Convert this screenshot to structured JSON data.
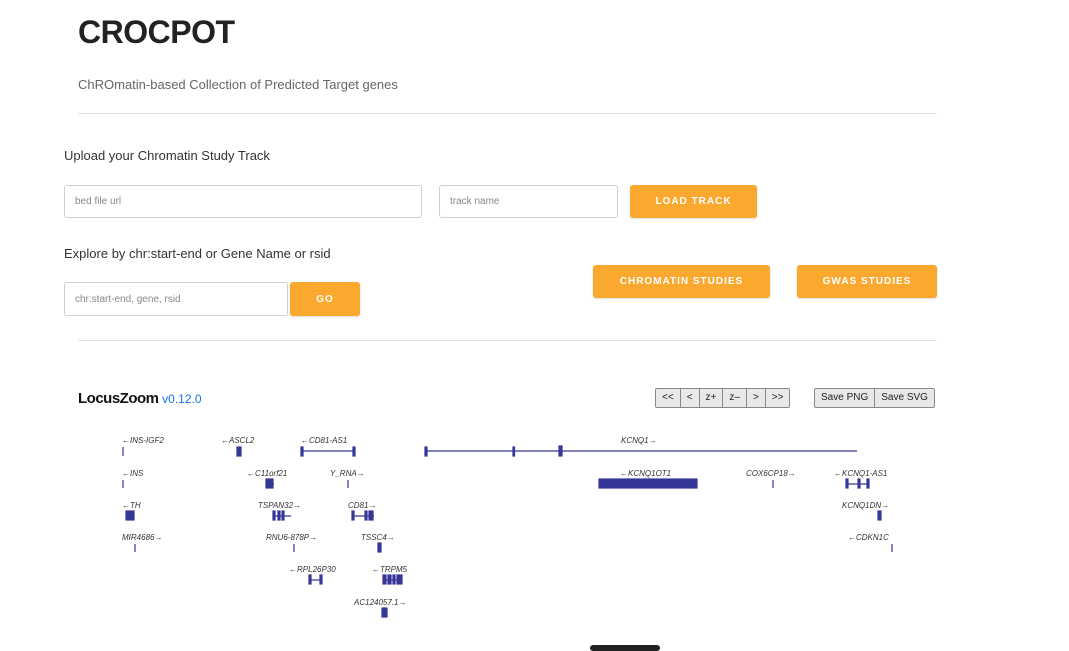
{
  "header": {
    "title": "CROCPOT",
    "subtitle": "ChROmatin-based Collection of Predicted Target genes"
  },
  "upload": {
    "label": "Upload your Chromatin Study Track",
    "bed_placeholder": "bed file url",
    "track_placeholder": "track name",
    "load_button": "LOAD TRACK"
  },
  "explore": {
    "label": "Explore by chr:start-end or Gene Name or rsid",
    "search_placeholder": "chr:start-end, gene, rsid",
    "go_button": "GO",
    "chromatin_button": "CHROMATIN STUDIES",
    "gwas_button": "GWAS STUDIES"
  },
  "locuszoom": {
    "name": "LocusZoom",
    "version": "v0.12.0",
    "nav_buttons": [
      "<<",
      "<",
      "z+",
      "z–",
      ">",
      ">>"
    ],
    "save_buttons": [
      "Save PNG",
      "Save SVG"
    ],
    "gene_color": "#363696",
    "genes": [
      {
        "label": "←INS-IGF2",
        "row": 0
      },
      {
        "label": "←ASCL2",
        "row": 0
      },
      {
        "label": "←CD81-AS1",
        "row": 0
      },
      {
        "label": "KCNQ1→",
        "row": 0
      },
      {
        "label": "←INS",
        "row": 1
      },
      {
        "label": "←C11orf21",
        "row": 1
      },
      {
        "label": "Y_RNA→",
        "row": 1
      },
      {
        "label": "←KCNQ1OT1",
        "row": 1
      },
      {
        "label": "COX6CP18→",
        "row": 1
      },
      {
        "label": "←KCNQ1-AS1",
        "row": 1
      },
      {
        "label": "←TH",
        "row": 2
      },
      {
        "label": "TSPAN32→",
        "row": 2
      },
      {
        "label": "CD81→",
        "row": 2
      },
      {
        "label": "KCNQ1DN→",
        "row": 2
      },
      {
        "label": "MIR4686→",
        "row": 3
      },
      {
        "label": "RNU6-878P→",
        "row": 3
      },
      {
        "label": "TSSC4→",
        "row": 3
      },
      {
        "label": "←CDKN1C",
        "row": 3
      },
      {
        "label": "←RPL26P30",
        "row": 4
      },
      {
        "label": "←TRPM5",
        "row": 4
      },
      {
        "label": "AC124057.1→",
        "row": 5
      }
    ]
  }
}
